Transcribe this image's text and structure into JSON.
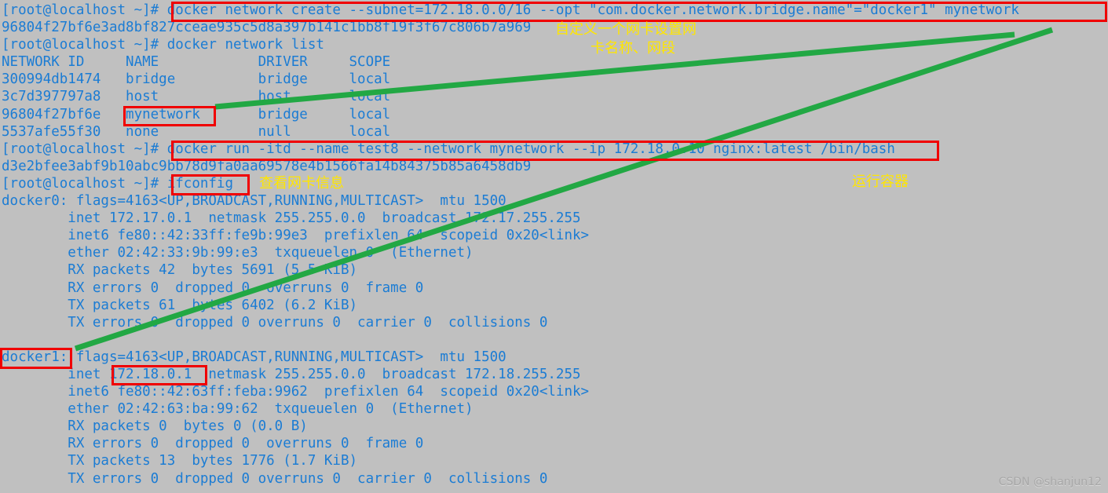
{
  "terminal": {
    "prompt": "[root@localhost ~]#",
    "lines": [
      "[root@localhost ~]# docker network create --subnet=172.18.0.0/16 --opt \"com.docker.network.bridge.name\"=\"docker1\" mynetwork",
      "96804f27bf6e3ad8bf827cceae935c5d8a397b141c1bb8f19f3f67c806b7a969",
      "[root@localhost ~]# docker network list",
      "NETWORK ID     NAME            DRIVER     SCOPE",
      "300994db1474   bridge          bridge     local",
      "3c7d397797a8   host            host       local",
      "96804f27bf6e   mynetwork       bridge     local",
      "5537afe55f30   none            null       local",
      "[root@localhost ~]# docker run -itd --name test8 --network mynetwork --ip 172.18.0.10 nginx:latest /bin/bash",
      "d3e2bfee3abf9b10abc9bb78d9fa0aa69578e4b1566fa14b84375b85a6458db9",
      "[root@localhost ~]# ifconfig",
      "docker0: flags=4163<UP,BROADCAST,RUNNING,MULTICAST>  mtu 1500",
      "        inet 172.17.0.1  netmask 255.255.0.0  broadcast 172.17.255.255",
      "        inet6 fe80::42:33ff:fe9b:99e3  prefixlen 64  scopeid 0x20<link>",
      "        ether 02:42:33:9b:99:e3  txqueuelen 0  (Ethernet)",
      "        RX packets 42  bytes 5691 (5.5 KiB)",
      "        RX errors 0  dropped 0  overruns 0  frame 0",
      "        TX packets 61  bytes 6402 (6.2 KiB)",
      "        TX errors 0  dropped 0 overruns 0  carrier 0  collisions 0",
      "",
      "docker1: flags=4163<UP,BROADCAST,RUNNING,MULTICAST>  mtu 1500",
      "        inet 172.18.0.1  netmask 255.255.0.0  broadcast 172.18.255.255",
      "        inet6 fe80::42:63ff:feba:9962  prefixlen 64  scopeid 0x20<link>",
      "        ether 02:42:63:ba:99:62  txqueuelen 0  (Ethernet)",
      "        RX packets 0  bytes 0 (0.0 B)",
      "        RX errors 0  dropped 0  overruns 0  frame 0",
      "        TX packets 13  bytes 1776 (1.7 KiB)",
      "        TX errors 0  dropped 0 overruns 0  carrier 0  collisions 0"
    ],
    "commands": {
      "network_create": "docker network create --subnet=172.18.0.0/16 --opt \"com.docker.network.bridge.name\"=\"docker1\" mynetwork",
      "network_list": "docker network list",
      "docker_run": "docker run -itd --name test8 --network mynetwork --ip 172.18.0.10 nginx:latest /bin/bash",
      "ifconfig": "ifconfig"
    },
    "network_table": {
      "headers": [
        "NETWORK ID",
        "NAME",
        "DRIVER",
        "SCOPE"
      ],
      "rows": [
        [
          "300994db1474",
          "bridge",
          "bridge",
          "local"
        ],
        [
          "3c7d397797a8",
          "host",
          "host",
          "local"
        ],
        [
          "96804f27bf6e",
          "mynetwork",
          "bridge",
          "local"
        ],
        [
          "5537afe55f30",
          "none",
          "null",
          "local"
        ]
      ]
    },
    "interfaces": [
      {
        "name": "docker0",
        "flags": "4163<UP,BROADCAST,RUNNING,MULTICAST>",
        "mtu": "1500",
        "inet": "172.17.0.1",
        "netmask": "255.255.0.0",
        "broadcast": "172.17.255.255",
        "inet6": "fe80::42:33ff:fe9b:99e3",
        "prefixlen": "64",
        "scopeid": "0x20<link>",
        "ether": "02:42:33:9b:99:e3",
        "txqueuelen": "0",
        "rx_packets": "42",
        "rx_bytes": "5691 (5.5 KiB)",
        "tx_packets": "61",
        "tx_bytes": "6402 (6.2 KiB)"
      },
      {
        "name": "docker1",
        "flags": "4163<UP,BROADCAST,RUNNING,MULTICAST>",
        "mtu": "1500",
        "inet": "172.18.0.1",
        "netmask": "255.255.0.0",
        "broadcast": "172.18.255.255",
        "inet6": "fe80::42:63ff:feba:9962",
        "prefixlen": "64",
        "scopeid": "0x20<link>",
        "ether": "02:42:63:ba:99:62",
        "txqueuelen": "0",
        "rx_packets": "0",
        "rx_bytes": "0 (0.0 B)",
        "tx_packets": "13",
        "tx_bytes": "1776 (1.7 KiB)"
      }
    ],
    "outputs": {
      "network_id_created": "96804f27bf6e3ad8bf827cceae935c5d8a397b141c1bb8f19f3f67c806b7a969",
      "container_id_created": "d3e2bfee3abf9b10abc9bb78d9fa0aa69578e4b1566fa14b84375b85a6458db9"
    }
  },
  "annotations": {
    "note_create_network": "自定义一个网卡设置网",
    "note_create_network_2": "卡名称、网段",
    "note_run_container": "运行容器",
    "note_ifconfig": "查看网卡信息"
  },
  "watermark": "CSDN @shanjun12",
  "colors": {
    "background": "#c0c0c0",
    "text": "#1b7cd4",
    "highlight_box": "#f00000",
    "annotation_text": "#ffe600",
    "connector_line": "#22a844"
  }
}
